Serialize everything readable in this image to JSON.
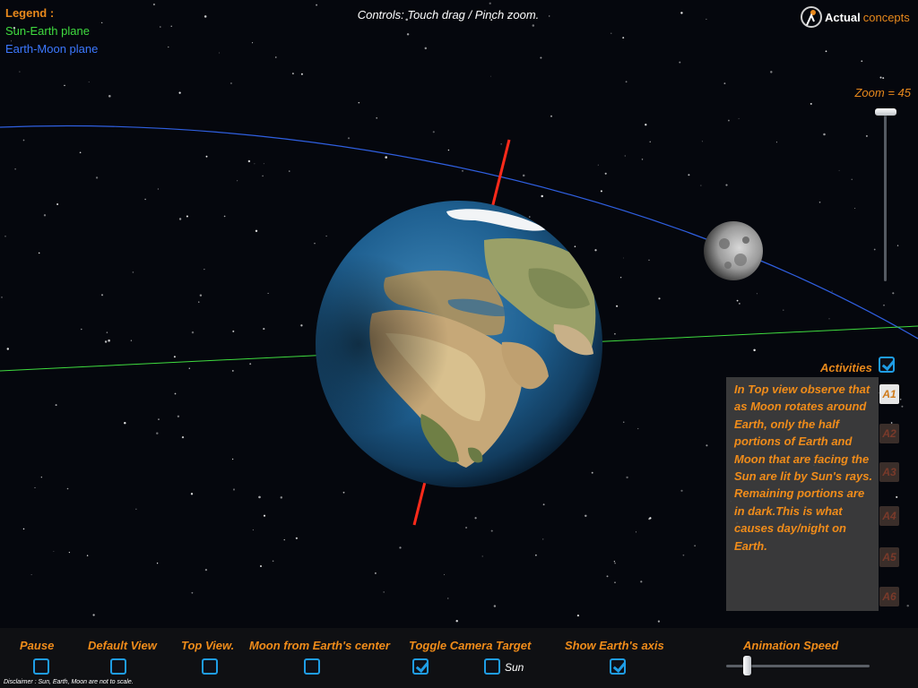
{
  "legend": {
    "title": "Legend :",
    "sun_earth": "Sun-Earth plane",
    "earth_moon": "Earth-Moon plane"
  },
  "controls_hint": "Controls: Touch drag / Pinch zoom.",
  "logo": {
    "word1": "Actual",
    "word2": "concepts"
  },
  "zoom": {
    "label": "Zoom = 45",
    "value": 45
  },
  "activities": {
    "label": "Activities",
    "checked": true,
    "text": "In Top view observe that as Moon rotates around Earth, only the half portions of Earth and Moon that are facing the Sun are lit by Sun's rays. Remaining portions are in dark.This is what causes day/night on Earth.",
    "buttons": [
      "A1",
      "A2",
      "A3",
      "A4",
      "A5",
      "A6"
    ],
    "selected": "A1"
  },
  "controls": {
    "pause": {
      "label": "Pause",
      "checked": false
    },
    "default_view": {
      "label": "Default View",
      "checked": false
    },
    "top_view": {
      "label": "Top View.",
      "checked": false
    },
    "moon_center": {
      "label": "Moon from Earth's center",
      "checked": false
    },
    "camera_target": {
      "label": "Toggle Camera Target",
      "checked": true,
      "sun_label": "Sun",
      "sun_checked": false
    },
    "earth_axis": {
      "label": "Show Earth's axis",
      "checked": true
    },
    "animation_speed": {
      "label": "Animation Speed"
    }
  },
  "disclaimer": "Disclaimer : Sun, Earth, Moon are not to scale.",
  "colors": {
    "accent": "#f08c1a",
    "sun_earth_plane": "#3fdc3f",
    "earth_moon_plane": "#2f5fe0",
    "earth_axis": "#ff2a1a",
    "checkbox": "#1f9de6"
  }
}
